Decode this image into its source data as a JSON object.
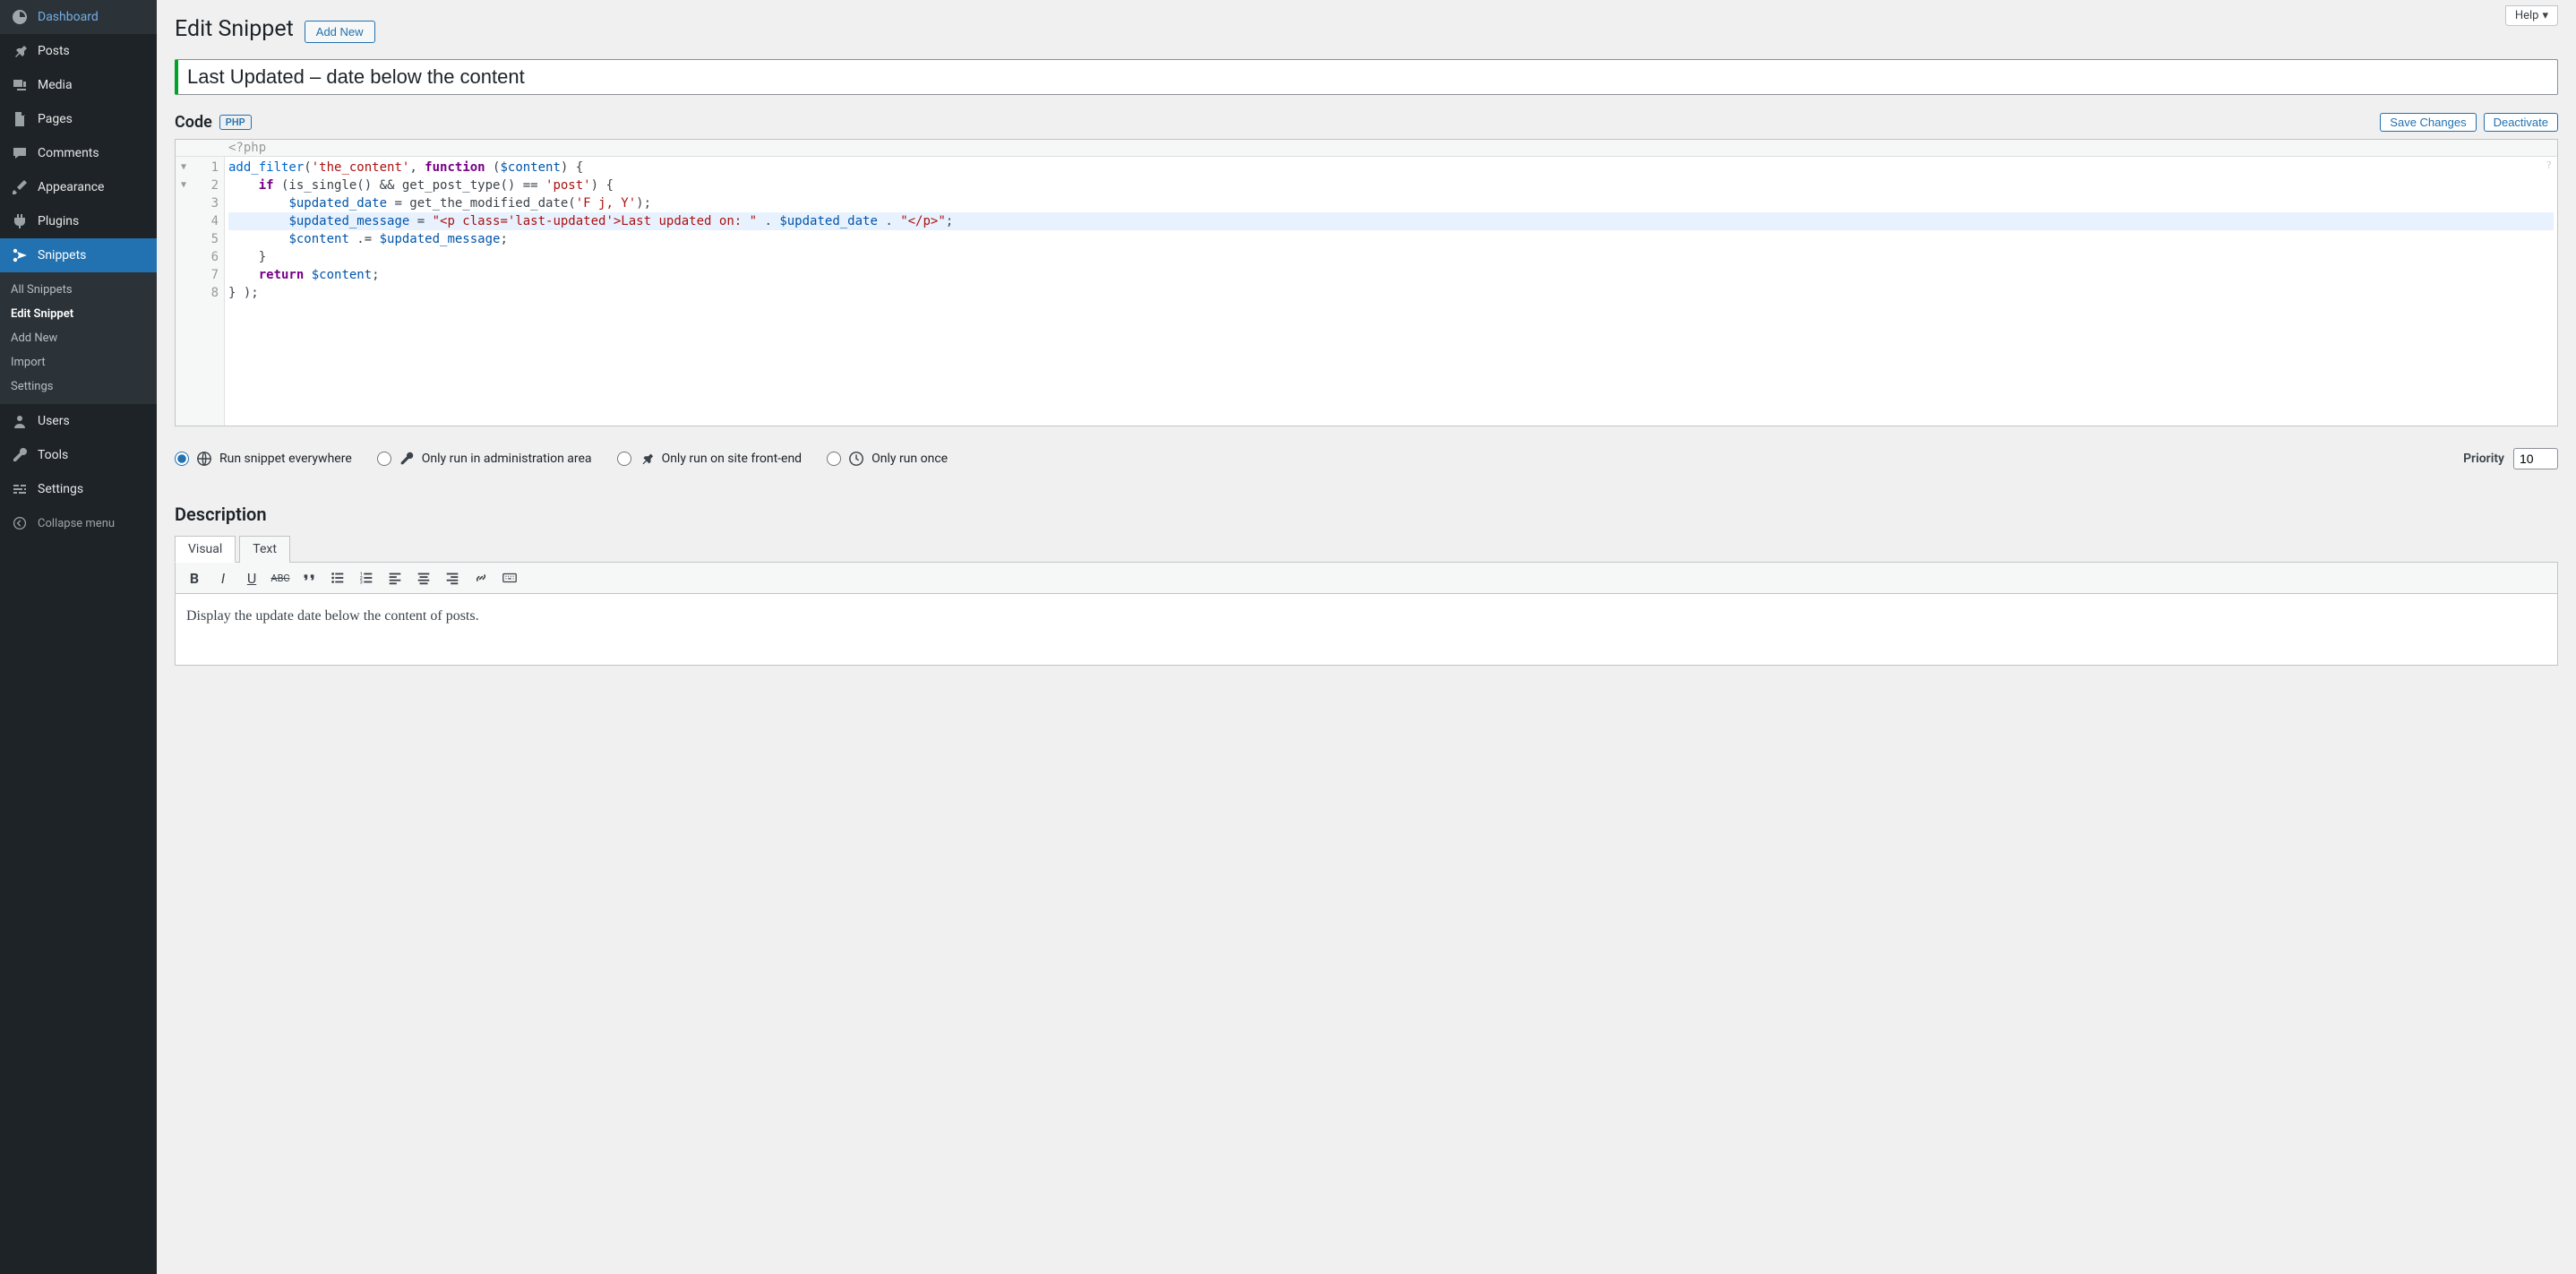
{
  "sidebar": {
    "items": [
      {
        "label": "Dashboard"
      },
      {
        "label": "Posts"
      },
      {
        "label": "Media"
      },
      {
        "label": "Pages"
      },
      {
        "label": "Comments"
      },
      {
        "label": "Appearance"
      },
      {
        "label": "Plugins"
      },
      {
        "label": "Snippets"
      },
      {
        "label": "Users"
      },
      {
        "label": "Tools"
      },
      {
        "label": "Settings"
      }
    ],
    "submenu": [
      {
        "label": "All Snippets"
      },
      {
        "label": "Edit Snippet"
      },
      {
        "label": "Add New"
      },
      {
        "label": "Import"
      },
      {
        "label": "Settings"
      }
    ],
    "collapse": "Collapse menu"
  },
  "help_label": "Help",
  "page": {
    "title": "Edit Snippet",
    "add_new": "Add New"
  },
  "snippet_title": "Last Updated – date below the content",
  "code": {
    "heading": "Code",
    "badge": "PHP",
    "save": "Save Changes",
    "deactivate": "Deactivate",
    "opener": "<?php",
    "lines": {
      "l1": {
        "a": "add_filter",
        "b": "(",
        "c": "'the_content'",
        "d": ", ",
        "e": "function",
        "f": " (",
        "g": "$content",
        "h": ") {"
      },
      "l2": {
        "a": "    ",
        "b": "if",
        "c": " (is_single() && get_post_type() == ",
        "d": "'post'",
        "e": ") {"
      },
      "l3": {
        "a": "        ",
        "b": "$updated_date",
        "c": " = get_the_modified_date(",
        "d": "'F j, Y'",
        "e": ");"
      },
      "l4": {
        "a": "        ",
        "b": "$updated_message",
        "c": " = ",
        "d": "\"<p class='last-updated'>Last updated on: \"",
        "e": " . ",
        "f": "$updated_date",
        "g": " . ",
        "h": "\"</p>\"",
        "i": ";"
      },
      "l5": {
        "a": "        ",
        "b": "$content",
        "c": " .= ",
        "d": "$updated_message",
        "e": ";"
      },
      "l6": {
        "a": "    }"
      },
      "l7": {
        "a": "    ",
        "b": "return",
        "c": " ",
        "d": "$content",
        "e": ";"
      },
      "l8": {
        "a": "} );"
      }
    }
  },
  "run": {
    "everywhere": "Run snippet everywhere",
    "admin": "Only run in administration area",
    "frontend": "Only run on site front-end",
    "once": "Only run once",
    "priority_label": "Priority",
    "priority_value": "10"
  },
  "description": {
    "heading": "Description",
    "tab_visual": "Visual",
    "tab_text": "Text",
    "content": "Display the update date below the content of posts."
  }
}
